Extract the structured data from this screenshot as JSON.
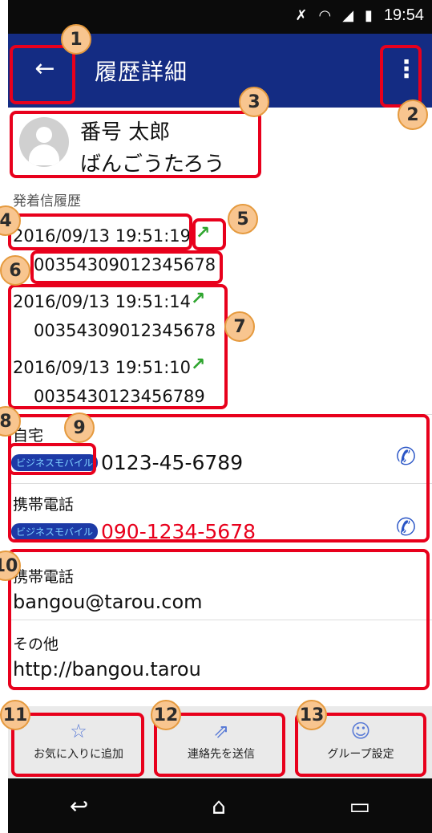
{
  "status_bar": {
    "time": "19:54"
  },
  "header": {
    "title": "履歴詳細",
    "back_icon": "arrow-left-icon",
    "menu_icon": "more-vert-icon"
  },
  "contact": {
    "name": "番号 太郎",
    "kana": "ばんごうたろう"
  },
  "history": {
    "section_label": "発着信履歴",
    "items": [
      {
        "timestamp": "2016/09/13 19:51:19",
        "number": "00354309012345678"
      },
      {
        "timestamp": "2016/09/13 19:51:14",
        "number": "00354309012345678"
      },
      {
        "timestamp": "2016/09/13 19:51:10",
        "number": "0035430123456789"
      }
    ]
  },
  "phones": [
    {
      "label": "自宅",
      "number": "0123-45-6789",
      "badge": "ビジネスモバイル",
      "color": "#111111"
    },
    {
      "label": "携帯電話",
      "number": "090-1234-5678",
      "badge": "ビジネスモバイル",
      "color": "#e8001c"
    }
  ],
  "emails": [
    {
      "label": "携帯電話",
      "value": "bangou@tarou.com"
    },
    {
      "label": "その他",
      "value": "http://bangou.tarou"
    }
  ],
  "actions": [
    {
      "label": "お気に入りに追加",
      "icon": "star-icon"
    },
    {
      "label": "連絡先を送信",
      "icon": "share-icon"
    },
    {
      "label": "グループ設定",
      "icon": "group-icon"
    }
  ],
  "callouts": [
    "1",
    "2",
    "3",
    "4",
    "5",
    "6",
    "7",
    "8",
    "9",
    "10",
    "11",
    "12",
    "13"
  ],
  "colors": {
    "appbar": "#142c83",
    "highlight": "#e8001c",
    "callout": "#f8c58f",
    "outgoing_arrow": "#2ea52e"
  }
}
